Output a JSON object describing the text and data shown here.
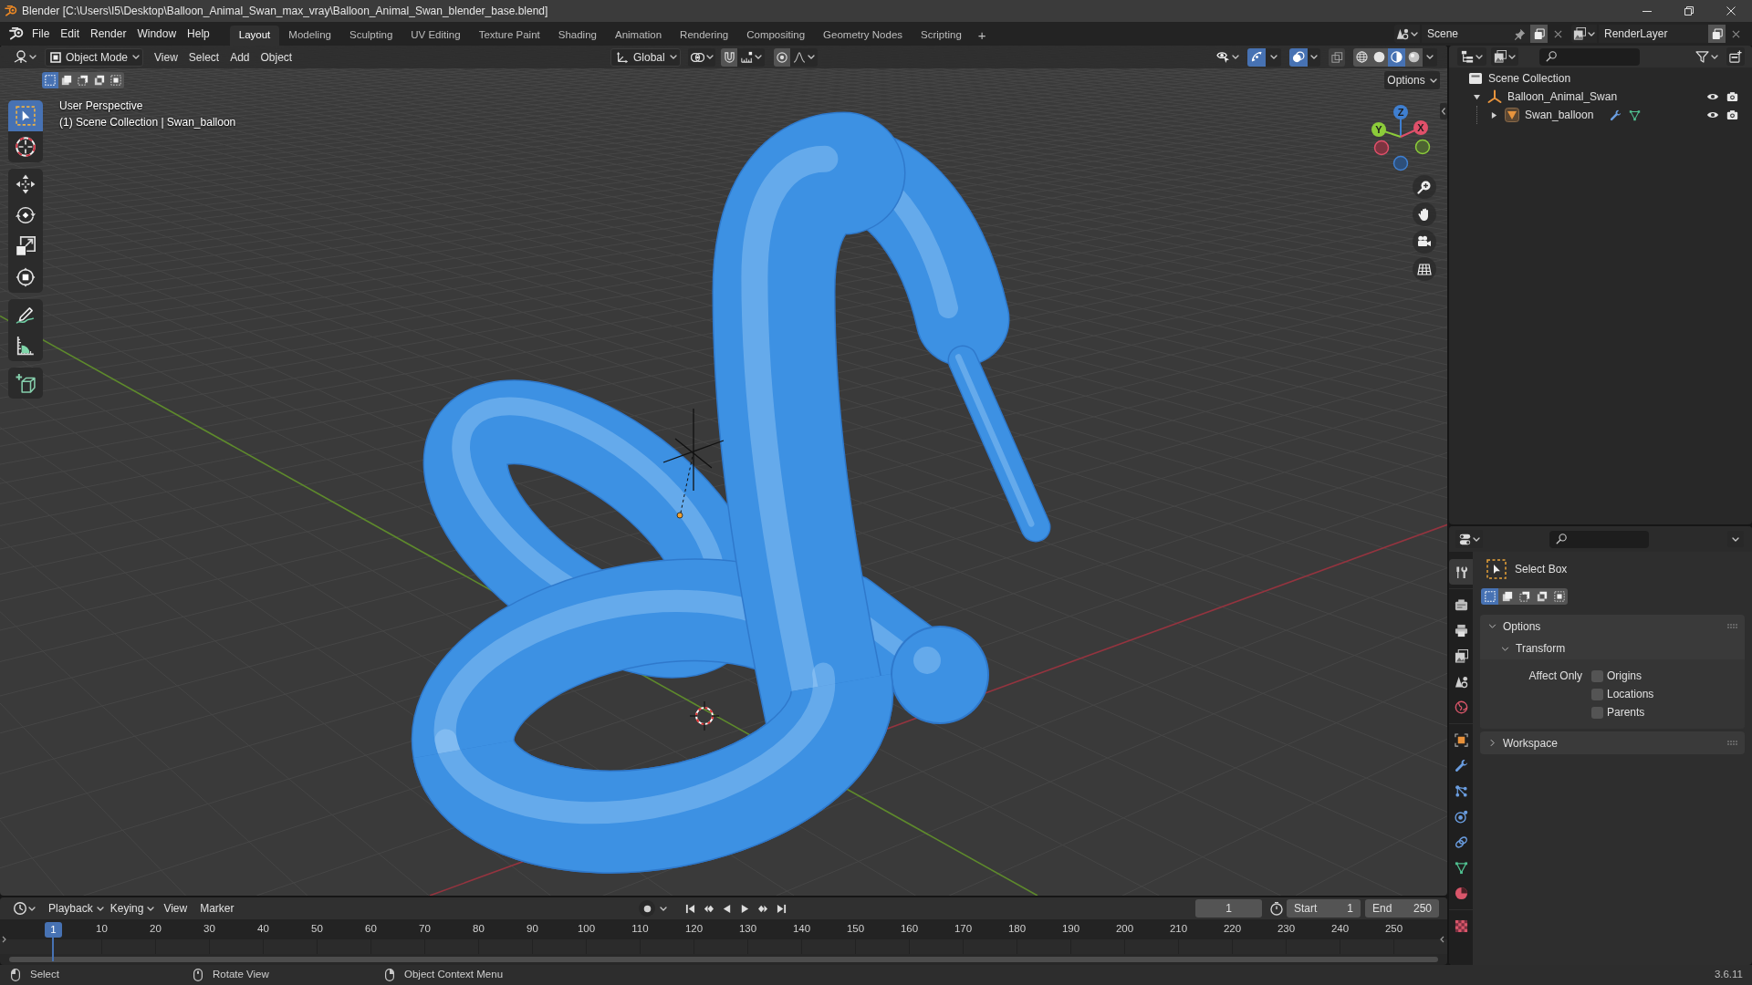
{
  "window": {
    "title": "Blender [C:\\Users\\I5\\Desktop\\Balloon_Animal_Swan_max_vray\\Balloon_Animal_Swan_blender_base.blend]"
  },
  "menu": [
    "File",
    "Edit",
    "Render",
    "Window",
    "Help"
  ],
  "workspaces": [
    {
      "label": "Layout",
      "selected": true
    },
    {
      "label": "Modeling",
      "selected": false
    },
    {
      "label": "Sculpting",
      "selected": false
    },
    {
      "label": "UV Editing",
      "selected": false
    },
    {
      "label": "Texture Paint",
      "selected": false
    },
    {
      "label": "Shading",
      "selected": false
    },
    {
      "label": "Animation",
      "selected": false
    },
    {
      "label": "Rendering",
      "selected": false
    },
    {
      "label": "Compositing",
      "selected": false
    },
    {
      "label": "Geometry Nodes",
      "selected": false
    },
    {
      "label": "Scripting",
      "selected": false
    }
  ],
  "add_workspace": "+",
  "scene_selector": {
    "scene": "Scene",
    "view_layer": "RenderLayer"
  },
  "viewport": {
    "mode": "Object Mode",
    "menus": [
      "View",
      "Select",
      "Add",
      "Object"
    ],
    "orientation": "Global",
    "gizmos": true,
    "overlays": true,
    "xray": false,
    "shading": [
      {
        "selected": false
      },
      {
        "selected": false
      },
      {
        "selected": true
      },
      {
        "selected": false
      }
    ],
    "select_modes": [
      {
        "selected": true
      },
      {
        "selected": false
      },
      {
        "selected": false
      },
      {
        "selected": false
      },
      {
        "selected": false
      }
    ],
    "options": "Options",
    "tools": [
      {
        "selected": true
      },
      {
        "selected": false
      },
      {
        "selected": false
      },
      {
        "selected": false
      },
      {
        "selected": false
      },
      {
        "selected": false
      },
      {
        "selected": false
      },
      {
        "selected": false
      },
      {
        "selected": false
      }
    ],
    "view_name": "User Perspective",
    "context": "(1) Scene Collection | Swan_balloon",
    "gizmo_axes": [
      "Z",
      "Y",
      "X"
    ]
  },
  "outliner": {
    "items": [
      {
        "label": "Scene Collection",
        "kind": "collection",
        "children": [
          {
            "label": "Balloon_Animal_Swan",
            "kind": "empty",
            "expanded": true,
            "children": [
              {
                "label": "Swan_balloon",
                "kind": "mesh",
                "expanded": false
              }
            ]
          }
        ]
      }
    ]
  },
  "properties": {
    "tabs": [
      {
        "selected": true
      },
      {
        "selected": false
      },
      {
        "selected": false
      },
      {
        "selected": false
      },
      {
        "selected": false
      },
      {
        "selected": false
      },
      {
        "selected": false
      },
      {
        "selected": false
      },
      {
        "selected": false
      },
      {
        "selected": false
      },
      {
        "selected": false
      },
      {
        "selected": false
      },
      {
        "selected": false
      },
      {
        "selected": false
      }
    ],
    "tool": "Select Box",
    "select_modes": [
      {
        "selected": true
      },
      {
        "selected": false
      },
      {
        "selected": false
      },
      {
        "selected": false
      },
      {
        "selected": false
      }
    ],
    "panels": [
      {
        "title": "Options",
        "expanded": true,
        "subpanels": [
          {
            "title": "Transform",
            "expanded": true,
            "label": "Affect Only",
            "checkboxes": [
              {
                "label": "Origins",
                "checked": false
              },
              {
                "label": "Locations",
                "checked": false
              },
              {
                "label": "Parents",
                "checked": false
              }
            ]
          }
        ]
      },
      {
        "title": "Workspace",
        "expanded": false
      }
    ]
  },
  "timeline": {
    "menus": [
      "Playback",
      "Keying",
      "View",
      "Marker"
    ],
    "current_frame": "1",
    "start_label": "Start",
    "start": "1",
    "end_label": "End",
    "end": "250",
    "playhead": "1",
    "ruler": [
      "10",
      "20",
      "30",
      "40",
      "50",
      "60",
      "70",
      "80",
      "90",
      "100",
      "110",
      "120",
      "130",
      "140",
      "150",
      "160",
      "170",
      "180",
      "190",
      "200",
      "210",
      "220",
      "230",
      "240",
      "250"
    ]
  },
  "status_bar": {
    "hints": [
      "Select",
      "Rotate View",
      "Object Context Menu"
    ],
    "version": "3.6.11"
  }
}
